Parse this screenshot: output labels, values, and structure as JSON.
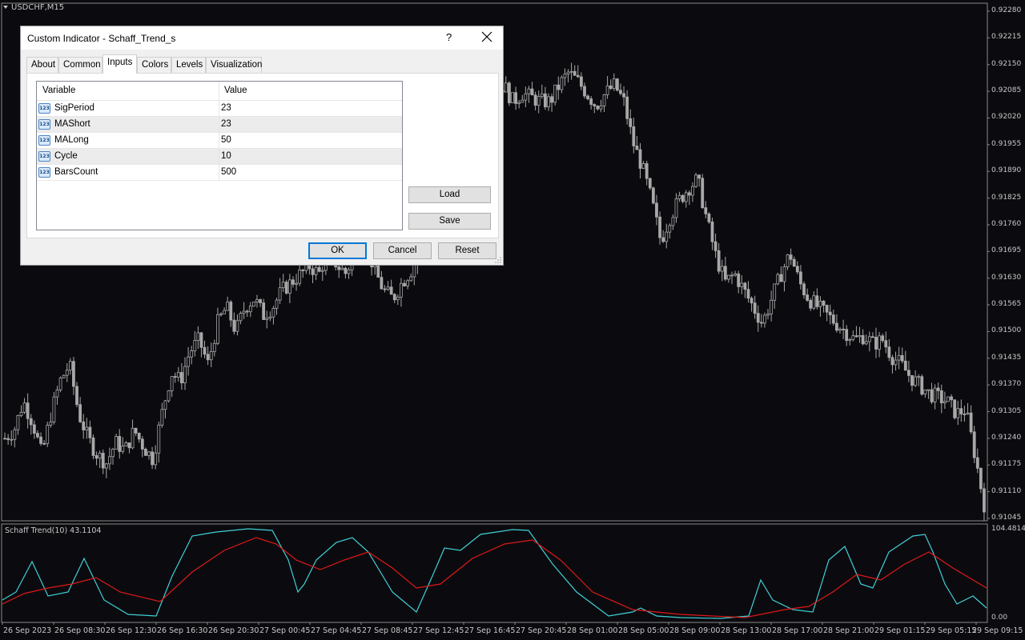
{
  "chart": {
    "symbol_title": "USDCHF,M15",
    "indicator_title": "Schaff Trend(10) 43.1104",
    "price_labels": [
      "0.92280",
      "0.92215",
      "0.92150",
      "0.92085",
      "0.92020",
      "0.91955",
      "0.91890",
      "0.91825",
      "0.91760",
      "0.91695",
      "0.91630",
      "0.91565",
      "0.91500",
      "0.91435",
      "0.91370",
      "0.91305",
      "0.91240",
      "0.91175",
      "0.91110",
      "0.91045"
    ],
    "indicator_labels": [
      "104.4814",
      "0.00"
    ],
    "time_labels": [
      "26 Sep 2023",
      "26 Sep 08:30",
      "26 Sep 12:30",
      "26 Sep 16:30",
      "26 Sep 20:30",
      "27 Sep 00:45",
      "27 Sep 04:45",
      "27 Sep 08:45",
      "27 Sep 12:45",
      "27 Sep 16:45",
      "27 Sep 20:45",
      "28 Sep 01:00",
      "28 Sep 05:00",
      "28 Sep 09:00",
      "28 Sep 13:00",
      "28 Sep 17:00",
      "28 Sep 21:00",
      "29 Sep 01:15",
      "29 Sep 05:15",
      "29 Sep 09:15"
    ],
    "colors": {
      "background": "#0b0b0f",
      "candle": "#a8a8a8",
      "fast_line": "#40d0d8",
      "slow_line": "#e01818"
    },
    "close_path": [
      0.9124,
      0.9126,
      0.9133,
      0.9128,
      0.912,
      0.913,
      0.9138,
      0.9142,
      0.913,
      0.9124,
      0.912,
      0.9118,
      0.9123,
      0.9121,
      0.9126,
      0.9122,
      0.9119,
      0.913,
      0.914,
      0.9138,
      0.9145,
      0.9148,
      0.9142,
      0.9152,
      0.9156,
      0.915,
      0.9156,
      0.9158,
      0.9154,
      0.9156,
      0.916,
      0.9162,
      0.9164,
      0.9166,
      0.9164,
      0.917,
      0.9166,
      0.9164,
      0.9172,
      0.9172,
      0.9165,
      0.916,
      0.9158,
      0.9162,
      0.9165,
      0.917,
      0.918,
      0.919,
      0.9205,
      0.9215,
      0.9222,
      0.9206,
      0.9205,
      0.9208,
      0.921,
      0.9206,
      0.9208,
      0.9207,
      0.9206,
      0.9206,
      0.921,
      0.9213,
      0.9211,
      0.9208,
      0.9205,
      0.9208,
      0.921,
      0.9206,
      0.9196,
      0.919,
      0.9182,
      0.9172,
      0.9178,
      0.9182,
      0.9185,
      0.9187,
      0.9177,
      0.9168,
      0.9162,
      0.9164,
      0.916,
      0.9156,
      0.9152,
      0.9158,
      0.9164,
      0.9169,
      0.9162,
      0.9158,
      0.9156,
      0.9154,
      0.9152,
      0.915,
      0.9148,
      0.9149,
      0.9147,
      0.9148,
      0.9144,
      0.9142,
      0.9139,
      0.9137,
      0.9135,
      0.9134,
      0.9133,
      0.913,
      0.9131,
      0.912,
      0.9108
    ]
  },
  "dialog": {
    "title": "Custom Indicator - Schaff_Trend_s",
    "help_label": "?",
    "tabs": [
      "About",
      "Common",
      "Inputs",
      "Colors",
      "Levels",
      "Visualization"
    ],
    "active_tab": "Inputs",
    "grid_headers": {
      "variable": "Variable",
      "value": "Value"
    },
    "param_icon_text": "123",
    "params": [
      {
        "name": "SigPeriod",
        "value": "23"
      },
      {
        "name": "MAShort",
        "value": "23"
      },
      {
        "name": "MALong",
        "value": "50"
      },
      {
        "name": "Cycle",
        "value": "10"
      },
      {
        "name": "BarsCount",
        "value": "500"
      }
    ],
    "load_label": "Load",
    "save_label": "Save",
    "ok_label": "OK",
    "cancel_label": "Cancel",
    "reset_label": "Reset"
  }
}
